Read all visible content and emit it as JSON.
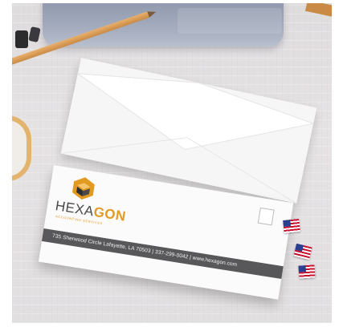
{
  "envelope": {
    "brand_part1": "HEXA",
    "brand_part2": "GON",
    "tagline": "ACCOUNTING SERVICES",
    "return_address": "735 Sherwood Circle Lafayette, LA 70503 | 337-299-0042 | www.hexagon.com"
  },
  "colors": {
    "brand_accent": "#e39a21",
    "band": "#58585a",
    "background": "#e2dfe1"
  },
  "icons": {
    "logo": "hexagon-logo-icon",
    "stamps": "us-flag-stamp"
  }
}
